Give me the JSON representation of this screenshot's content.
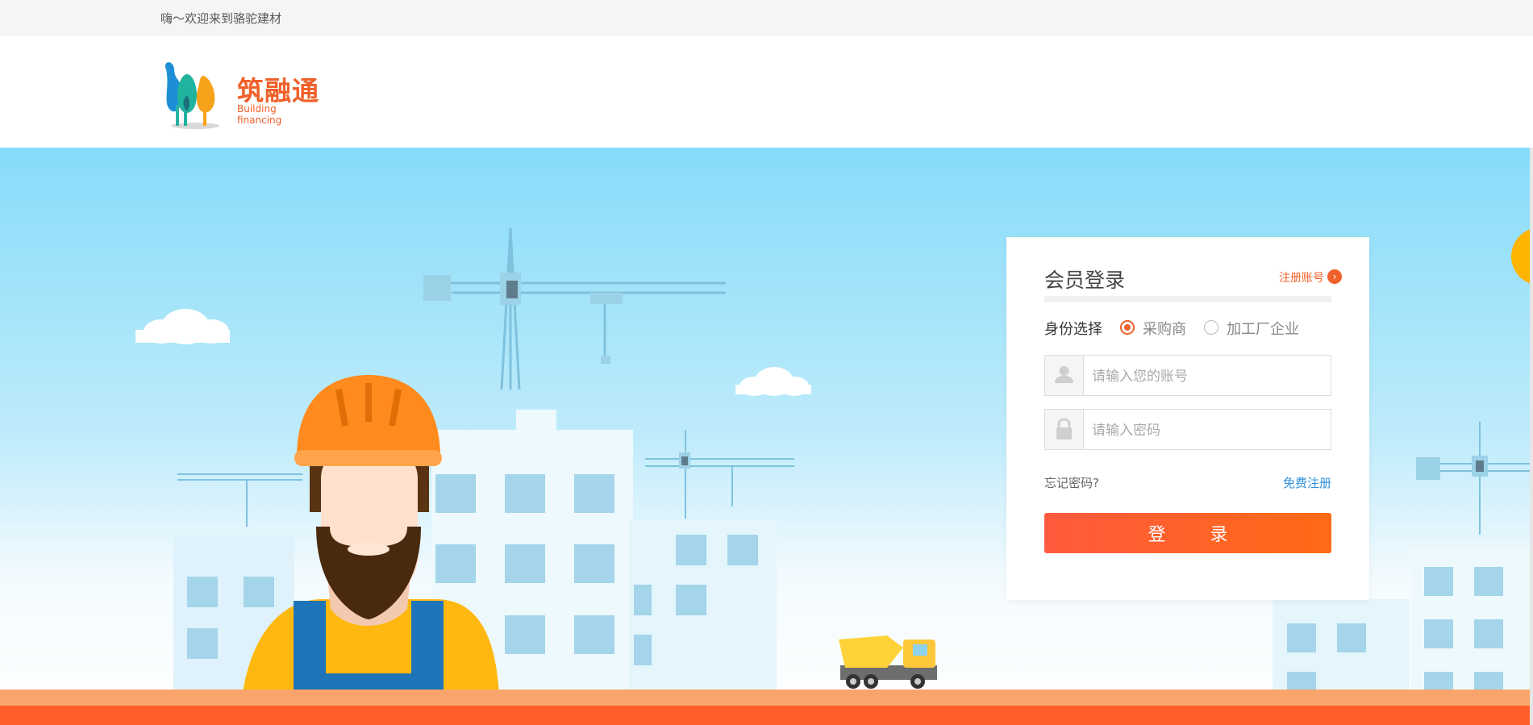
{
  "topbar": {
    "welcome": "嗨～欢迎来到骆驼建材"
  },
  "logo": {
    "brand_cn": "筑融通",
    "brand_en": "Building financing"
  },
  "login": {
    "title": "会员登录",
    "register_link": "注册账号",
    "role_label": "身份选择",
    "roles": [
      {
        "label": "采购商",
        "checked": true
      },
      {
        "label": "加工厂企业",
        "checked": false
      }
    ],
    "account_placeholder": "请输入您的账号",
    "password_placeholder": "请输入密码",
    "forgot": "忘记密码?",
    "free_register": "免费注册",
    "submit": "登 录"
  },
  "colors": {
    "accent": "#f0602a",
    "link_blue": "#2f8fd8",
    "sky_top": "#86dcf9",
    "helmet": "#ff8a1e",
    "ground": "#ff5d2a"
  }
}
